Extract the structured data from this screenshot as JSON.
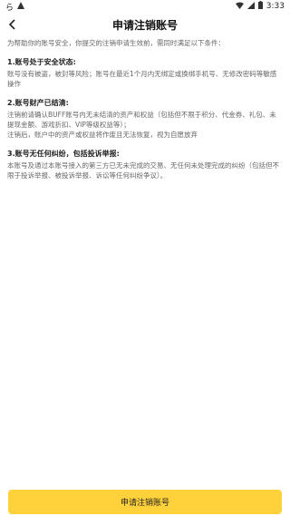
{
  "status_bar": {
    "left_text": "ら",
    "time": "3:33"
  },
  "header": {
    "title": "申请注销账号"
  },
  "content": {
    "intro": "为帮助你的账号安全，你提交的注销申请生效前，需同时满足以下条件：",
    "sections": [
      {
        "title": "1.账号处于安全状态:",
        "body": [
          "账号没有被盗，被封等风险；账号在最近1个月内无绑定或换绑手机号、无修改密码等敏感操作"
        ]
      },
      {
        "title": "2.账号财产已结清:",
        "body": [
          "注销前请确认BUFF账号内无未结清的资产和权益（包括但不限于积分、代金券、礼包、未提现金额、游戏折扣、VIP等级权益等）；",
          "注销后，账户中的资产或权益将作废且无法恢复，视为自愿放弃"
        ]
      },
      {
        "title": "3.账号无任何纠纷，包括投诉举报:",
        "body": [
          "本账号及通过本账号接入的第三方已无未完成的交易、无任何未处理完成的纠纷（包括但不限于投诉举报、被投诉举报、诉讼等任何纠纷争议）。"
        ]
      }
    ]
  },
  "footer": {
    "submit_label": "申请注销账号"
  },
  "colors": {
    "accent": "#FFD23B"
  }
}
